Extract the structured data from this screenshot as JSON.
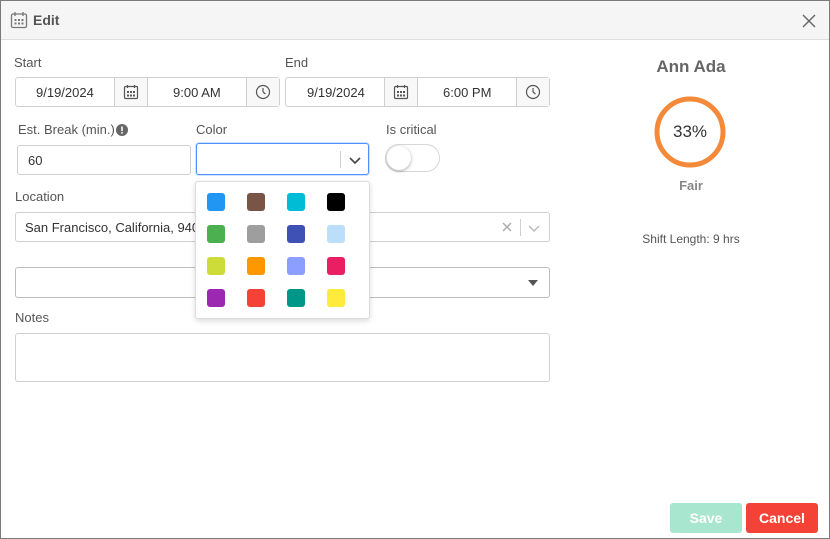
{
  "dialog": {
    "title": "Edit"
  },
  "start": {
    "label": "Start",
    "date": "9/19/2024",
    "time": "9:00 AM"
  },
  "end": {
    "label": "End",
    "date": "9/19/2024",
    "time": "6:00 PM"
  },
  "break": {
    "label": "Est. Break (min.)",
    "value": "60"
  },
  "color": {
    "label": "Color",
    "value": "",
    "palette": [
      "#2196f3",
      "#795548",
      "#00bcd4",
      "#000000",
      "#4caf50",
      "#9e9e9e",
      "#3f51b5",
      "#bbdefb",
      "#cddc39",
      "#ff9800",
      "#8c9eff",
      "#e91e63",
      "#9c27b0",
      "#f44336",
      "#009688",
      "#ffeb3b"
    ]
  },
  "critical": {
    "label": "Is critical",
    "on": false
  },
  "location": {
    "label": "Location",
    "value": "San Francisco, California, 9401"
  },
  "extra_select": {
    "value": ""
  },
  "notes": {
    "label": "Notes",
    "value": ""
  },
  "employee": {
    "name": "Ann Ada",
    "score_text": "33%",
    "score": 0.33,
    "rating": "Fair",
    "rating_color": "#f5893a",
    "shift_length": "Shift Length: 9 hrs"
  },
  "buttons": {
    "save": "Save",
    "cancel": "Cancel"
  }
}
